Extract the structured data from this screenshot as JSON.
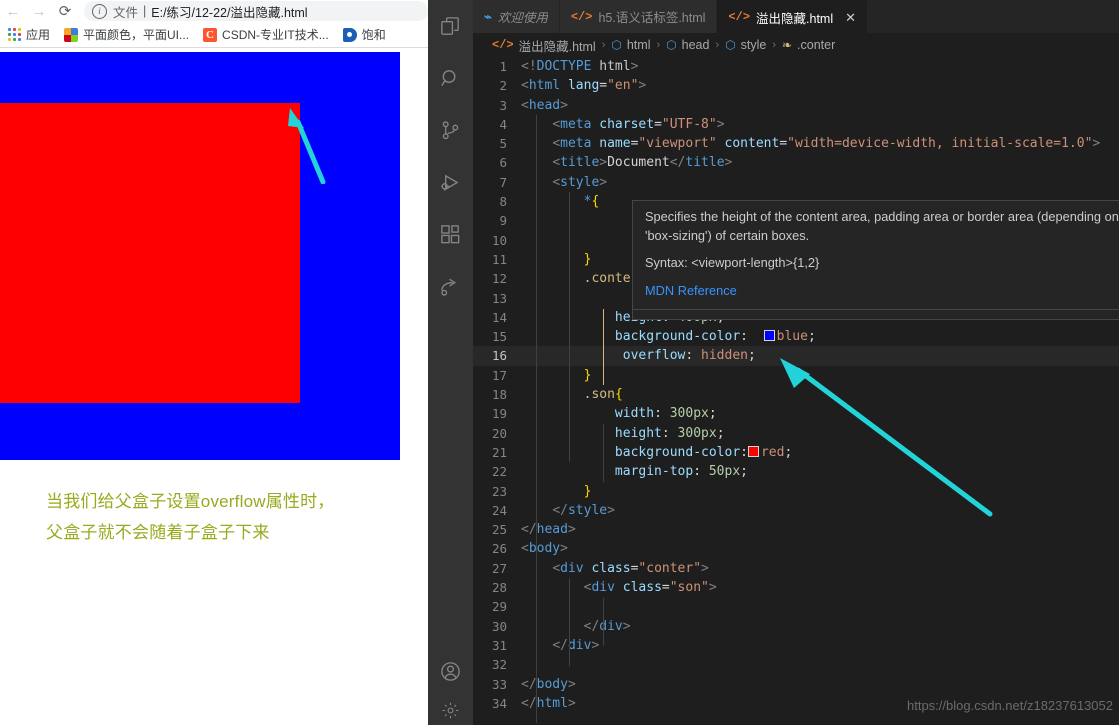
{
  "browser": {
    "nav": {
      "back": "←",
      "forward": "→",
      "reload": "⟳"
    },
    "omnibox": {
      "info_icon": "i",
      "scheme_label": "文件",
      "separator": "|",
      "url": "E:/练习/12-22/溢出隐藏.html"
    },
    "bookmarks": [
      {
        "label": "应用",
        "icon": "apps-grid-icon"
      },
      {
        "label": "平面颜色，平面UI...",
        "icon": "color-swatch-icon"
      },
      {
        "label": "CSDN-专业IT技术...",
        "icon": "csdn-icon"
      },
      {
        "label": "饱和",
        "icon": "blue-dot-icon"
      }
    ],
    "page": {
      "parent_box_color": "#0000ff",
      "child_box_color": "#ff0000",
      "annotation_line1": "当我们给父盒子设置overflow属性时，",
      "annotation_line2": "父盒子就不会随着子盒子下来",
      "annotation_color": "#9aaa1e",
      "arrow_color": "#22d3d8"
    }
  },
  "vscode": {
    "activity_bar": [
      {
        "name": "explorer-icon",
        "title": "资源管理器"
      },
      {
        "name": "search-icon",
        "title": "搜索"
      },
      {
        "name": "source-control-icon",
        "title": "源代码管理"
      },
      {
        "name": "run-debug-icon",
        "title": "运行和调试"
      },
      {
        "name": "extensions-icon",
        "title": "扩展"
      },
      {
        "name": "live-share-icon",
        "title": "Live Share"
      },
      {
        "name": "account-icon",
        "title": "帐户"
      }
    ],
    "tabs": [
      {
        "label": "欢迎使用",
        "icon": "vscode-logo-icon",
        "active": false,
        "italic": true,
        "closable": false
      },
      {
        "label": "h5.语义话标签.html",
        "icon": "html-file-icon",
        "active": false,
        "italic": false,
        "closable": false
      },
      {
        "label": "溢出隐藏.html",
        "icon": "html-file-icon",
        "active": true,
        "italic": false,
        "closable": true,
        "close_label": "✕"
      }
    ],
    "breadcrumb": [
      {
        "label": "溢出隐藏.html",
        "icon": "html-file-icon"
      },
      {
        "label": "html",
        "icon": "element-cube-icon"
      },
      {
        "label": "head",
        "icon": "element-cube-icon"
      },
      {
        "label": "style",
        "icon": "element-cube-icon"
      },
      {
        "label": ".conter",
        "icon": "css-rule-icon"
      }
    ],
    "breadcrumb_separator": "›",
    "current_line": 16,
    "code_lines": [
      {
        "n": 1,
        "text": "<!DOCTYPE html>"
      },
      {
        "n": 2,
        "text": "<html lang=\"en\">"
      },
      {
        "n": 3,
        "text": "<head>"
      },
      {
        "n": 4,
        "text": "    <meta charset=\"UTF-8\">"
      },
      {
        "n": 5,
        "text": "    <meta name=\"viewport\" content=\"width=device-width, initial-scale=1.0\">"
      },
      {
        "n": 6,
        "text": "    <title>Document</title>"
      },
      {
        "n": 7,
        "text": "    <style>"
      },
      {
        "n": 8,
        "text": "        *{"
      },
      {
        "n": 9,
        "text": ""
      },
      {
        "n": 10,
        "text": ""
      },
      {
        "n": 11,
        "text": "        }"
      },
      {
        "n": 12,
        "text": "        .conter{"
      },
      {
        "n": 13,
        "text": ""
      },
      {
        "n": 14,
        "text": "            height: 400px;"
      },
      {
        "n": 15,
        "text": "            background-color: blue;"
      },
      {
        "n": 16,
        "text": "            overflow: hidden;"
      },
      {
        "n": 17,
        "text": "        }"
      },
      {
        "n": 18,
        "text": "        .son{"
      },
      {
        "n": 19,
        "text": "            width: 300px;"
      },
      {
        "n": 20,
        "text": "            height: 300px;"
      },
      {
        "n": 21,
        "text": "            background-color: red;"
      },
      {
        "n": 22,
        "text": "            margin-top: 50px;"
      },
      {
        "n": 23,
        "text": "        }"
      },
      {
        "n": 24,
        "text": "    </style>"
      },
      {
        "n": 25,
        "text": "</head>"
      },
      {
        "n": 26,
        "text": "<body>"
      },
      {
        "n": 27,
        "text": "    <div class=\"conter\">"
      },
      {
        "n": 28,
        "text": "        <div class=\"son\">"
      },
      {
        "n": 29,
        "text": ""
      },
      {
        "n": 30,
        "text": "        </div>"
      },
      {
        "n": 31,
        "text": "    </div>"
      },
      {
        "n": 32,
        "text": ""
      },
      {
        "n": 33,
        "text": "</body>"
      },
      {
        "n": 34,
        "text": "</html>"
      }
    ],
    "hover_tooltip": {
      "description": "Specifies the height of the content area, padding area or border area (depending on 'box-sizing') of certain boxes.",
      "syntax": "Syntax: <viewport-length>{1,2}",
      "link": "MDN Reference"
    },
    "arrow_color": "#22d3d8"
  },
  "watermark": "https://blog.csdn.net/z18237613052"
}
